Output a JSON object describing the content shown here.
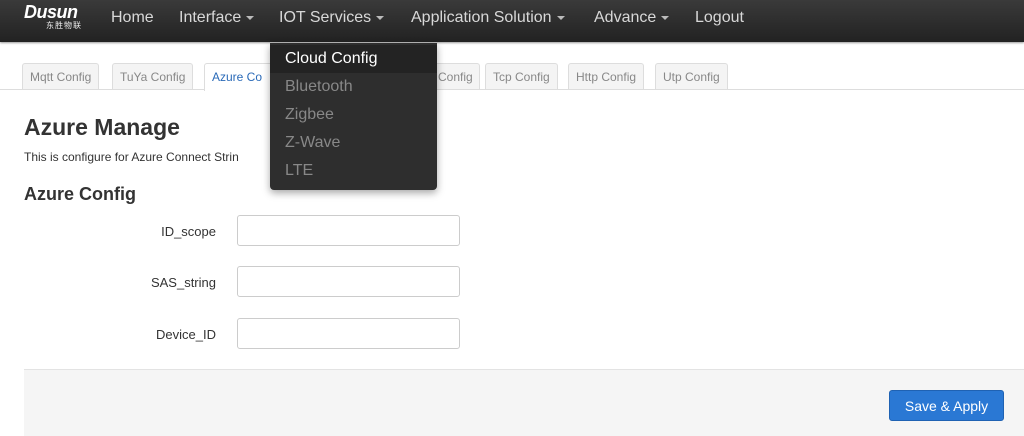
{
  "brand": {
    "name": "Dusun",
    "subtitle": "东胜物联"
  },
  "nav": {
    "items": [
      {
        "label": "Home",
        "has_caret": false
      },
      {
        "label": "Interface",
        "has_caret": true
      },
      {
        "label": "IOT Services",
        "has_caret": true
      },
      {
        "label": "Application Solution",
        "has_caret": true
      },
      {
        "label": "Advance",
        "has_caret": true
      },
      {
        "label": "Logout",
        "has_caret": false
      }
    ]
  },
  "dropdown": {
    "items": [
      {
        "label": "Cloud Config",
        "active": true
      },
      {
        "label": "Bluetooth",
        "active": false
      },
      {
        "label": "Zigbee",
        "active": false
      },
      {
        "label": "Z-Wave",
        "active": false
      },
      {
        "label": "LTE",
        "active": false
      }
    ]
  },
  "tabs": [
    {
      "label": "Mqtt Config",
      "active": false
    },
    {
      "label": "TuYa Config",
      "active": false
    },
    {
      "label": "Azure Co",
      "active": true
    },
    {
      "label": "Config",
      "active": false
    },
    {
      "label": "Tcp Config",
      "active": false
    },
    {
      "label": "Http Config",
      "active": false
    },
    {
      "label": "Utp Config",
      "active": false
    }
  ],
  "page": {
    "title": "Azure Manage",
    "description": "This is configure for Azure Connect Strin"
  },
  "section": {
    "title": "Azure Config",
    "fields": [
      {
        "label": "ID_scope",
        "value": ""
      },
      {
        "label": "SAS_string",
        "value": ""
      },
      {
        "label": "Device_ID",
        "value": ""
      }
    ]
  },
  "footer": {
    "save_label": "Save & Apply"
  },
  "colors": {
    "navbar": "#222222",
    "accent": "#2a78d4",
    "dropdown_bg": "#2e2e2e"
  }
}
